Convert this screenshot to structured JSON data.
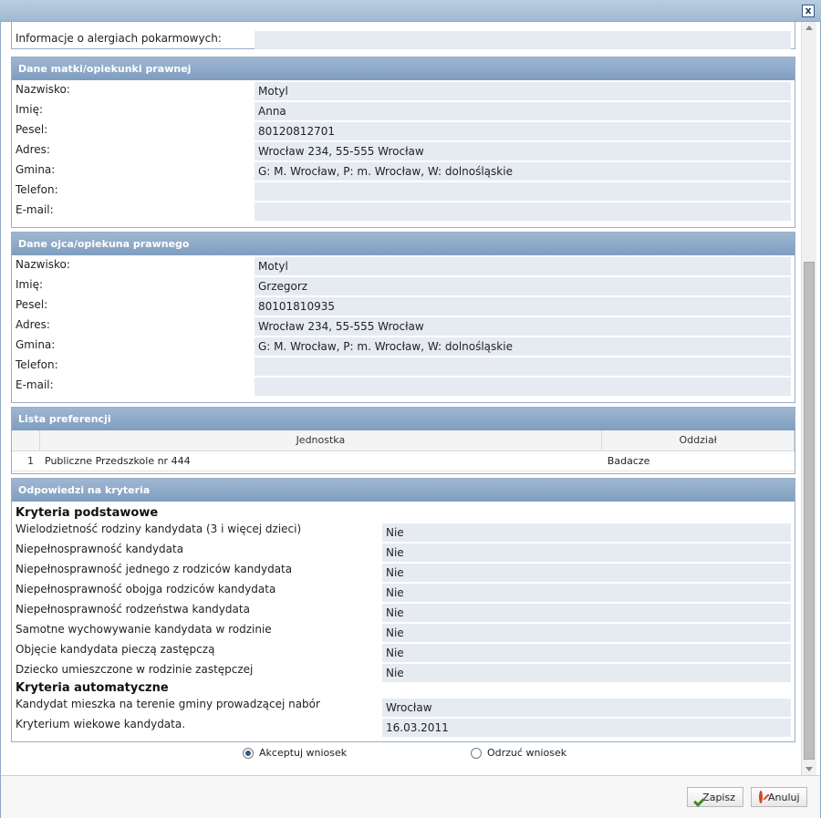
{
  "window": {
    "close_symbol": "x"
  },
  "top_partial": {
    "label": "Informacje o alergiach pokarmowych:",
    "value": ""
  },
  "mother": {
    "header": "Dane matki/opiekunki prawnej",
    "fields": [
      {
        "label": "Nazwisko:",
        "value": "Motyl"
      },
      {
        "label": "Imię:",
        "value": "Anna"
      },
      {
        "label": "Pesel:",
        "value": "80120812701"
      },
      {
        "label": "Adres:",
        "value": "Wrocław 234, 55-555 Wrocław"
      },
      {
        "label": "Gmina:",
        "value": "G: M. Wrocław, P: m. Wrocław, W: dolnośląskie"
      },
      {
        "label": "Telefon:",
        "value": ""
      },
      {
        "label": "E-mail:",
        "value": ""
      }
    ]
  },
  "father": {
    "header": "Dane ojca/opiekuna prawnego",
    "fields": [
      {
        "label": "Nazwisko:",
        "value": "Motyl"
      },
      {
        "label": "Imię:",
        "value": "Grzegorz"
      },
      {
        "label": "Pesel:",
        "value": "80101810935"
      },
      {
        "label": "Adres:",
        "value": "Wrocław 234, 55-555 Wrocław"
      },
      {
        "label": "Gmina:",
        "value": "G: M. Wrocław, P: m. Wrocław, W: dolnośląskie"
      },
      {
        "label": "Telefon:",
        "value": ""
      },
      {
        "label": "E-mail:",
        "value": ""
      }
    ]
  },
  "preferences": {
    "header": "Lista preferencji",
    "columns": [
      "Jednostka",
      "Oddział"
    ],
    "rows": [
      {
        "index": "1",
        "unit": "Publiczne Przedszkole nr 444",
        "department": "Badacze"
      }
    ]
  },
  "criteria": {
    "header": "Odpowiedzi na kryteria",
    "basic_title": "Kryteria podstawowe",
    "basic": [
      {
        "label": "Wielodzietność rodziny kandydata (3 i więcej dzieci)",
        "value": "Nie"
      },
      {
        "label": "Niepełnosprawność kandydata",
        "value": "Nie"
      },
      {
        "label": "Niepełnosprawność jednego z rodziców kandydata",
        "value": "Nie"
      },
      {
        "label": "Niepełnosprawność obojga rodziców kandydata",
        "value": "Nie"
      },
      {
        "label": "Niepełnosprawność rodzeństwa kandydata",
        "value": "Nie"
      },
      {
        "label": "Samotne wychowywanie kandydata w rodzinie",
        "value": "Nie"
      },
      {
        "label": "Objęcie kandydata pieczą zastępczą",
        "value": "Nie"
      },
      {
        "label": "Dziecko umieszczone w rodzinie zastępczej",
        "value": "Nie"
      }
    ],
    "auto_title": "Kryteria automatyczne",
    "auto": [
      {
        "label": "Kandydat mieszka na terenie gminy prowadzącej nabór",
        "value": "Wrocław"
      },
      {
        "label": "Kryterium wiekowe kandydata.",
        "value": "16.03.2011"
      }
    ]
  },
  "decision": {
    "accept_label": "Akceptuj wniosek",
    "reject_label": "Odrzuć wniosek",
    "selected": "accept"
  },
  "footer": {
    "save_label": "Zapisz",
    "cancel_label": "Anuluj"
  },
  "colors": {
    "header_bg": "#8aa6c6",
    "value_bg": "#e6ebf2",
    "save_icon": "#3b8c24",
    "cancel_icon": "#d4462f"
  }
}
